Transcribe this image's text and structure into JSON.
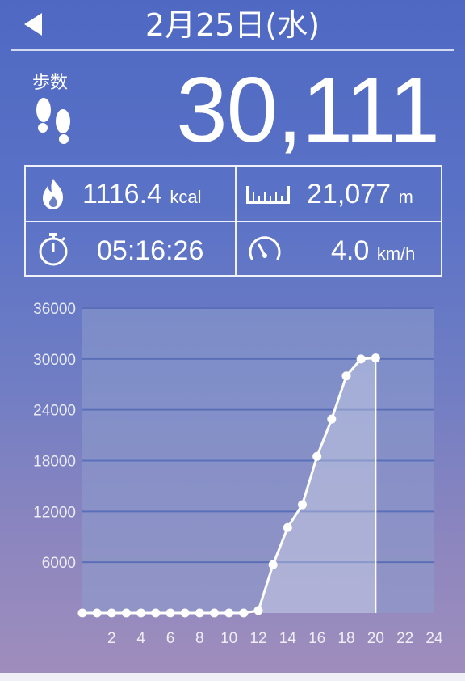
{
  "header": {
    "date": "2月25日(水)",
    "back_icon": "back-arrow-icon"
  },
  "steps": {
    "label": "歩数",
    "value": "30,111",
    "icon": "footprint-icon"
  },
  "stats": {
    "calories": {
      "value": "1116.4",
      "unit": "kcal",
      "icon": "flame-icon"
    },
    "distance": {
      "value": "21,077",
      "unit": "m",
      "icon": "ruler-icon"
    },
    "time": {
      "value": "05:16:26",
      "unit": "",
      "icon": "stopwatch-icon"
    },
    "speed": {
      "value": "4.0",
      "unit": "km/h",
      "icon": "speedometer-icon"
    }
  },
  "colors": {
    "background_top": "#4f69c3",
    "background_bottom": "#a08ebc",
    "plot_fill": "#8e9ccc",
    "gridline": "#5b6fb8",
    "line": "#ffffff"
  },
  "chart_data": {
    "type": "line",
    "title": "",
    "xlabel": "",
    "ylabel": "",
    "x_ticks": [
      "2",
      "4",
      "6",
      "8",
      "10",
      "12",
      "14",
      "16",
      "18",
      "20",
      "22",
      "24"
    ],
    "y_ticks": [
      "6000",
      "12000",
      "18000",
      "24000",
      "30000",
      "36000"
    ],
    "xlim": [
      0,
      24
    ],
    "ylim": [
      0,
      36000
    ],
    "grid": true,
    "series": [
      {
        "x": [
          0,
          1,
          2,
          3,
          4,
          5,
          6,
          7,
          8,
          9,
          10,
          11,
          12,
          13,
          14,
          15,
          16,
          17,
          18,
          19,
          20
        ],
        "y": [
          0,
          0,
          0,
          0,
          0,
          0,
          0,
          0,
          0,
          0,
          0,
          0,
          300,
          5700,
          10100,
          12800,
          18500,
          22900,
          28000,
          30000,
          30111
        ]
      }
    ]
  }
}
